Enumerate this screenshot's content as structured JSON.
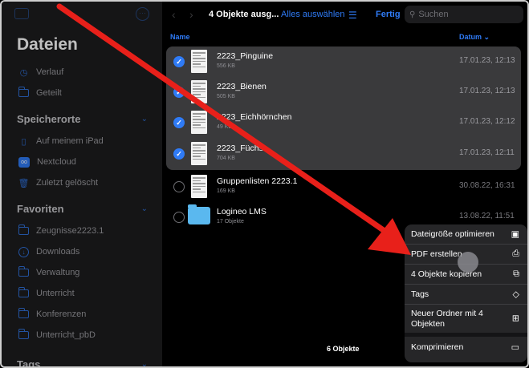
{
  "sidebar": {
    "title": "Dateien",
    "top_items": [
      {
        "label": "Verlauf",
        "icon": "clock-icon"
      },
      {
        "label": "Geteilt",
        "icon": "shared-folder-icon"
      }
    ],
    "sections": [
      {
        "label": "Speicherorte",
        "items": [
          {
            "label": "Auf meinem iPad",
            "icon": "ipad-icon"
          },
          {
            "label": "Nextcloud",
            "icon": "nextcloud-icon"
          },
          {
            "label": "Zuletzt gelöscht",
            "icon": "trash-icon"
          }
        ]
      },
      {
        "label": "Favoriten",
        "items": [
          {
            "label": "Zeugnisse2223.1",
            "icon": "folder-icon"
          },
          {
            "label": "Downloads",
            "icon": "download-icon"
          },
          {
            "label": "Verwaltung",
            "icon": "folder-icon"
          },
          {
            "label": "Unterricht",
            "icon": "folder-icon"
          },
          {
            "label": "Konferenzen",
            "icon": "folder-icon"
          },
          {
            "label": "Unterricht_pbD",
            "icon": "folder-icon"
          }
        ]
      },
      {
        "label": "Tags",
        "items": []
      }
    ]
  },
  "toolbar": {
    "title": "4 Objekte ausg...",
    "select_all": "Alles auswählen",
    "done": "Fertig",
    "search_placeholder": "Suchen"
  },
  "columns": {
    "name": "Name",
    "date": "Datum"
  },
  "files": [
    {
      "name": "2223_Pinguine",
      "size": "556 KB",
      "date": "17.01.23, 12:13",
      "selected": true,
      "type": "document"
    },
    {
      "name": "2223_Bienen",
      "size": "505 KB",
      "date": "17.01.23, 12:13",
      "selected": true,
      "type": "document"
    },
    {
      "name": "2223_Eichhörnchen",
      "size": "49 KB",
      "date": "17.01.23, 12:12",
      "selected": true,
      "type": "document"
    },
    {
      "name": "2223_Füchse",
      "size": "704 KB",
      "date": "17.01.23, 12:11",
      "selected": true,
      "type": "document"
    },
    {
      "name": "Gruppenlisten 2223.1",
      "size": "169 KB",
      "date": "30.08.22, 16:31",
      "selected": false,
      "type": "document"
    },
    {
      "name": "Logineo LMS",
      "size": "17 Objekte",
      "date": "13.08.22, 11:51",
      "selected": false,
      "type": "folder"
    }
  ],
  "footer_count": "6 Objekte",
  "context_menu": [
    {
      "label": "Dateigröße optimieren",
      "icon": "compress-doc-icon"
    },
    {
      "label": "PDF erstellen",
      "icon": "pdf-doc-icon"
    },
    {
      "label": "4 Objekte kopieren",
      "icon": "copy-icon"
    },
    {
      "label": "Tags",
      "icon": "tag-icon"
    },
    {
      "label": "Neuer Ordner mit 4 Objekten",
      "icon": "new-folder-icon"
    },
    {
      "label": "Komprimieren",
      "icon": "archive-box-icon"
    }
  ],
  "colors": {
    "accent": "#2f7bf6",
    "annotation_arrow": "#e8201a",
    "selection": "#3a3a3c"
  }
}
